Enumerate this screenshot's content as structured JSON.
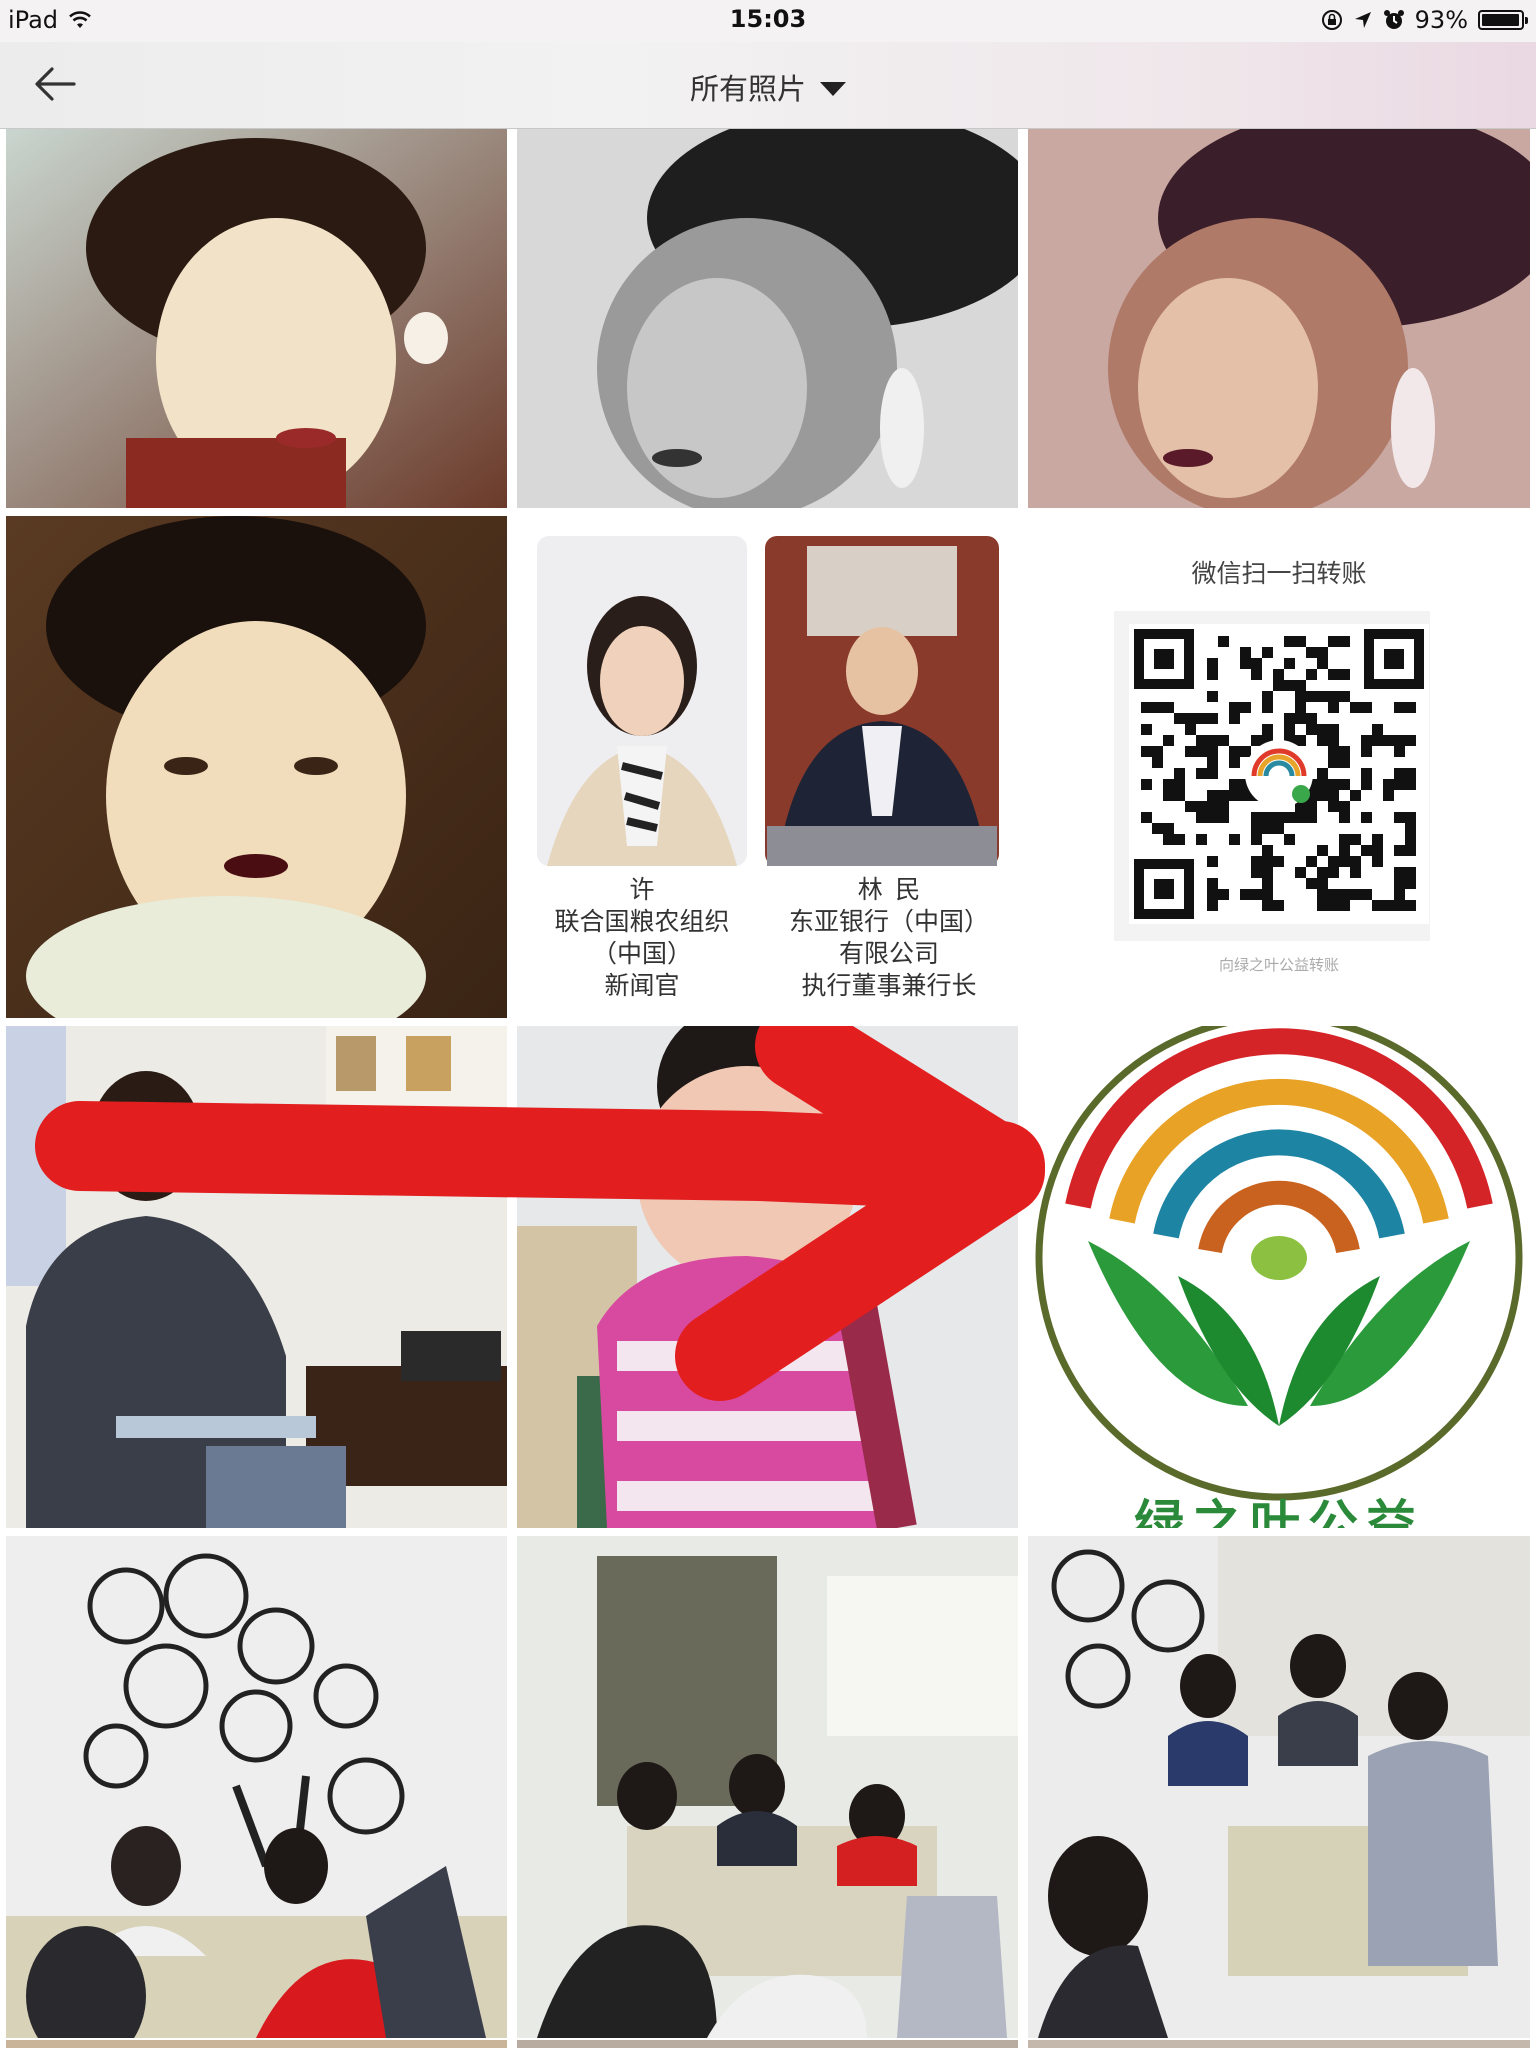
{
  "status": {
    "device": "iPad",
    "time": "15:03",
    "battery": "93%"
  },
  "header": {
    "title": "所有照片",
    "back_icon": "back-arrow-icon",
    "dropdown_icon": "caret-down-icon"
  },
  "cards": {
    "person1": {
      "name": "许",
      "lines": [
        "联合国粮农组织",
        "（中国）",
        "新闻官"
      ]
    },
    "person2": {
      "name": "林",
      "name2": "民",
      "lines": [
        "东亚银行（中国）",
        "有限公司",
        "执行董事兼行长"
      ]
    },
    "qr": {
      "title": "微信扫一扫转账",
      "footer": "向绿之叶公益转账"
    },
    "logo": {
      "text": "绿之叶公益"
    }
  }
}
